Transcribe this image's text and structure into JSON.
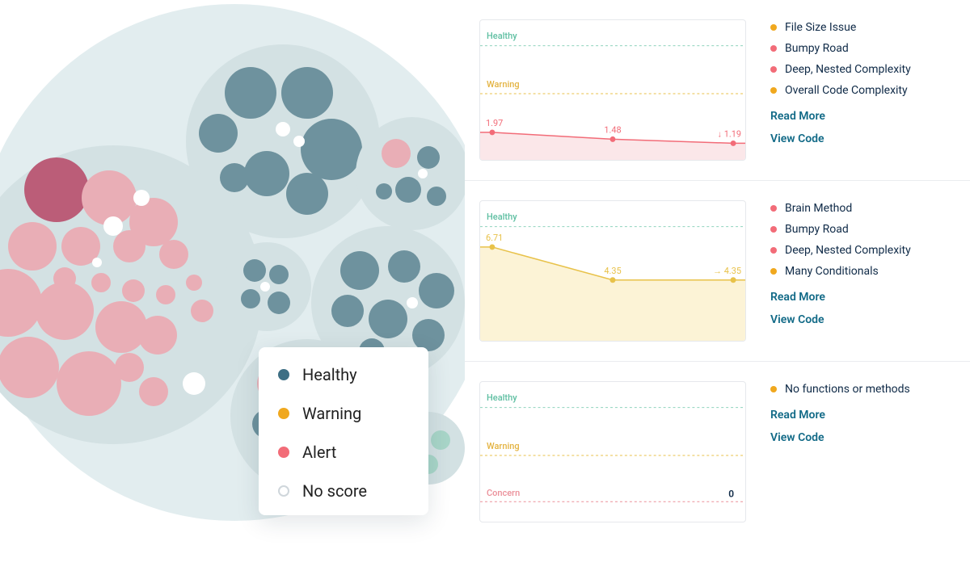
{
  "legend": {
    "healthy": {
      "label": "Healthy",
      "color": "#3e6f84"
    },
    "warning": {
      "label": "Warning",
      "color": "#f0a81e"
    },
    "alert": {
      "label": "Alert",
      "color": "#f26c78"
    },
    "noscore": {
      "label": "No score",
      "stroke": "#cfd6db",
      "fill": "#ffffff"
    }
  },
  "bands": {
    "healthy": "Healthy",
    "warning": "Warning",
    "concern": "Concern"
  },
  "actions": {
    "read_more": "Read More",
    "view_code": "View Code"
  },
  "issue_colors": {
    "red": "#f26c78",
    "yellow": "#f0a81e",
    "blue": "#3e6f84"
  },
  "files": [
    {
      "issues": [
        {
          "label": "File Size Issue",
          "sev": "yellow"
        },
        {
          "label": "Bumpy Road",
          "sev": "red"
        },
        {
          "label": "Deep, Nested Complexity",
          "sev": "red"
        },
        {
          "label": "Overall Code Complexity",
          "sev": "yellow"
        }
      ],
      "spark": {
        "color": "#f26c78",
        "fill": "#fbe7e9",
        "show_bands": [
          "healthy",
          "warning"
        ],
        "points": [
          {
            "v": 1.97,
            "label": "1.97"
          },
          {
            "v": 1.48,
            "label": "1.48"
          },
          {
            "v": 1.19,
            "label": "1.19",
            "trend": "down"
          }
        ],
        "range": [
          0,
          10
        ],
        "baseline": 1.3
      }
    },
    {
      "issues": [
        {
          "label": "Brain Method",
          "sev": "red"
        },
        {
          "label": "Bumpy Road",
          "sev": "red"
        },
        {
          "label": "Deep, Nested Complexity",
          "sev": "red"
        },
        {
          "label": "Many Conditionals",
          "sev": "yellow"
        }
      ],
      "spark": {
        "color": "#e8c24a",
        "fill": "#fcf3d6",
        "show_bands": [
          "healthy"
        ],
        "points": [
          {
            "v": 6.71,
            "label": "6.71"
          },
          {
            "v": 4.35,
            "label": "4.35"
          },
          {
            "v": 4.35,
            "label": "4.35",
            "trend": "right"
          }
        ],
        "range": [
          0,
          10
        ],
        "baseline": 4.0
      }
    },
    {
      "issues": [
        {
          "label": "No functions or methods",
          "sev": "yellow"
        }
      ],
      "spark": {
        "color": "#888",
        "fill": "none",
        "show_bands": [
          "healthy",
          "warning",
          "concern"
        ],
        "points": [],
        "right_value": "0",
        "range": [
          0,
          10
        ]
      }
    }
  ],
  "chart_data": [
    {
      "type": "line",
      "title": "Code Health Trend (File 1)",
      "x": [
        1,
        2,
        3
      ],
      "values": [
        1.97,
        1.48,
        1.19
      ],
      "ylim": [
        0,
        10
      ],
      "bands": [
        "Healthy",
        "Warning"
      ]
    },
    {
      "type": "line",
      "title": "Code Health Trend (File 2)",
      "x": [
        1,
        2,
        3
      ],
      "values": [
        6.71,
        4.35,
        4.35
      ],
      "ylim": [
        0,
        10
      ],
      "bands": [
        "Healthy"
      ]
    },
    {
      "type": "line",
      "title": "Code Health Trend (File 3)",
      "x": [],
      "values": [],
      "right_value": 0,
      "ylim": [
        0,
        10
      ],
      "bands": [
        "Healthy",
        "Warning",
        "Concern"
      ]
    }
  ]
}
